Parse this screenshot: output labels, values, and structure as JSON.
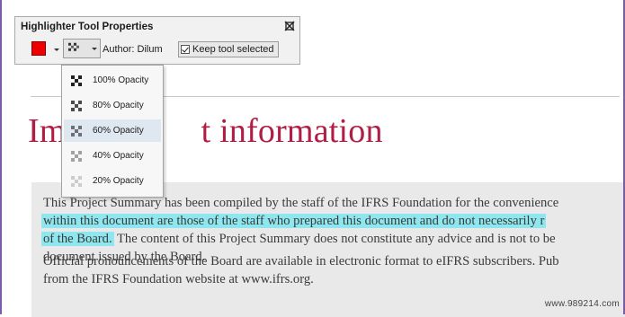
{
  "toolbar": {
    "title": "Highlighter Tool Properties",
    "color": "#ec0000",
    "author_label": "Author: Dilum",
    "keep_tool_label": "Keep tool selected",
    "keep_tool_checked": true
  },
  "opacity_menu": {
    "selected_index": 2,
    "items": [
      {
        "label": "100% Opacity",
        "opacity": 1.0
      },
      {
        "label": "80% Opacity",
        "opacity": 0.8
      },
      {
        "label": "60% Opacity",
        "opacity": 0.6
      },
      {
        "label": "40% Opacity",
        "opacity": 0.4
      },
      {
        "label": "20% Opacity",
        "opacity": 0.2
      }
    ]
  },
  "document": {
    "heading_visible_left": "Im",
    "heading_visible_right": "t information",
    "para1": {
      "line1": "This Project Summary has been compiled by the staff of the IFRS Foundation for the convenience",
      "line2": "within this document are those of the staff who prepared this document and do not necessarily r",
      "line3_highlight": "of the Board.",
      "line3_rest": " The content of this Project Summary does not constitute any advice and is not to be",
      "line4": "document issued by the Board."
    },
    "para2": {
      "line1": "Official pronouncements of the Board are available in electronic format to eIFRS subscribers.  Pub",
      "line2": "from the IFRS Foundation website at www.ifrs.org."
    },
    "highlight_color": "#8ee7ef"
  },
  "watermark": "www.989214.com"
}
